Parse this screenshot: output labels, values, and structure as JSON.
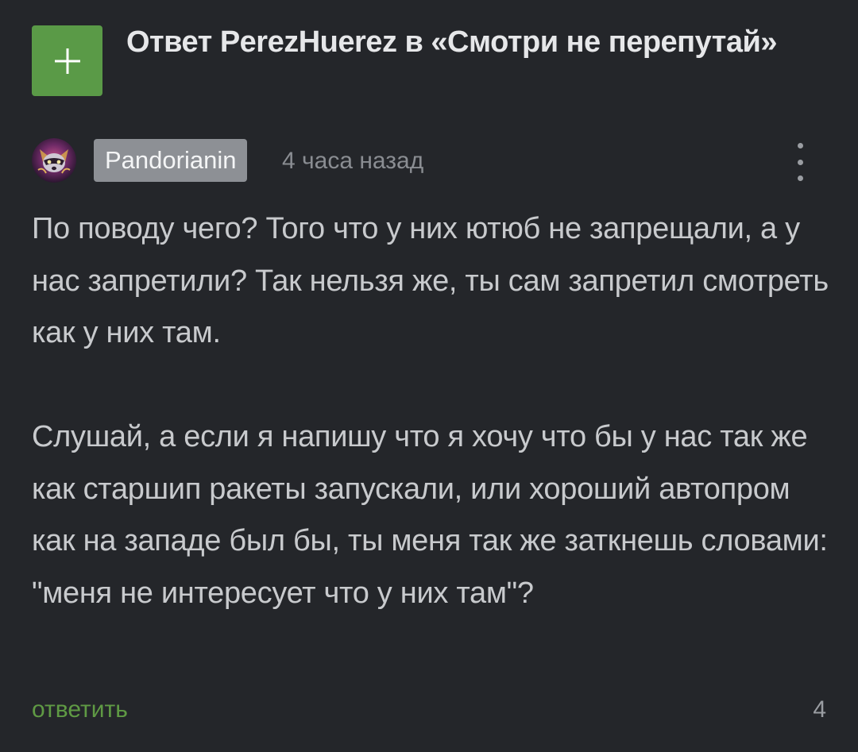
{
  "header": {
    "title": "Ответ PerezHuerez в «Смотри не перепутай»",
    "plus_icon": "plus-icon",
    "accent_color": "#5a9a47"
  },
  "comment": {
    "avatar_icon": "raccoon-avatar-icon",
    "username": "Pandorianin",
    "time": "4 часа назад",
    "more_icon": "kebab-menu-icon",
    "paragraphs": [
      "По поводу чего? Того что у них ютюб не запрещали, а у нас запретили? Так нельзя же, ты сам запретил смотреть как у них там.",
      "Слушай, а если я напишу что я хочу что бы у нас так же как старшип ракеты запускали, или хороший автопром как на западе был бы, ты меня так же заткнешь словами: \"меня не интересует что у них там\"?"
    ],
    "reply_label": "ответить",
    "rating": "4",
    "reply_color": "#5f9a44"
  }
}
